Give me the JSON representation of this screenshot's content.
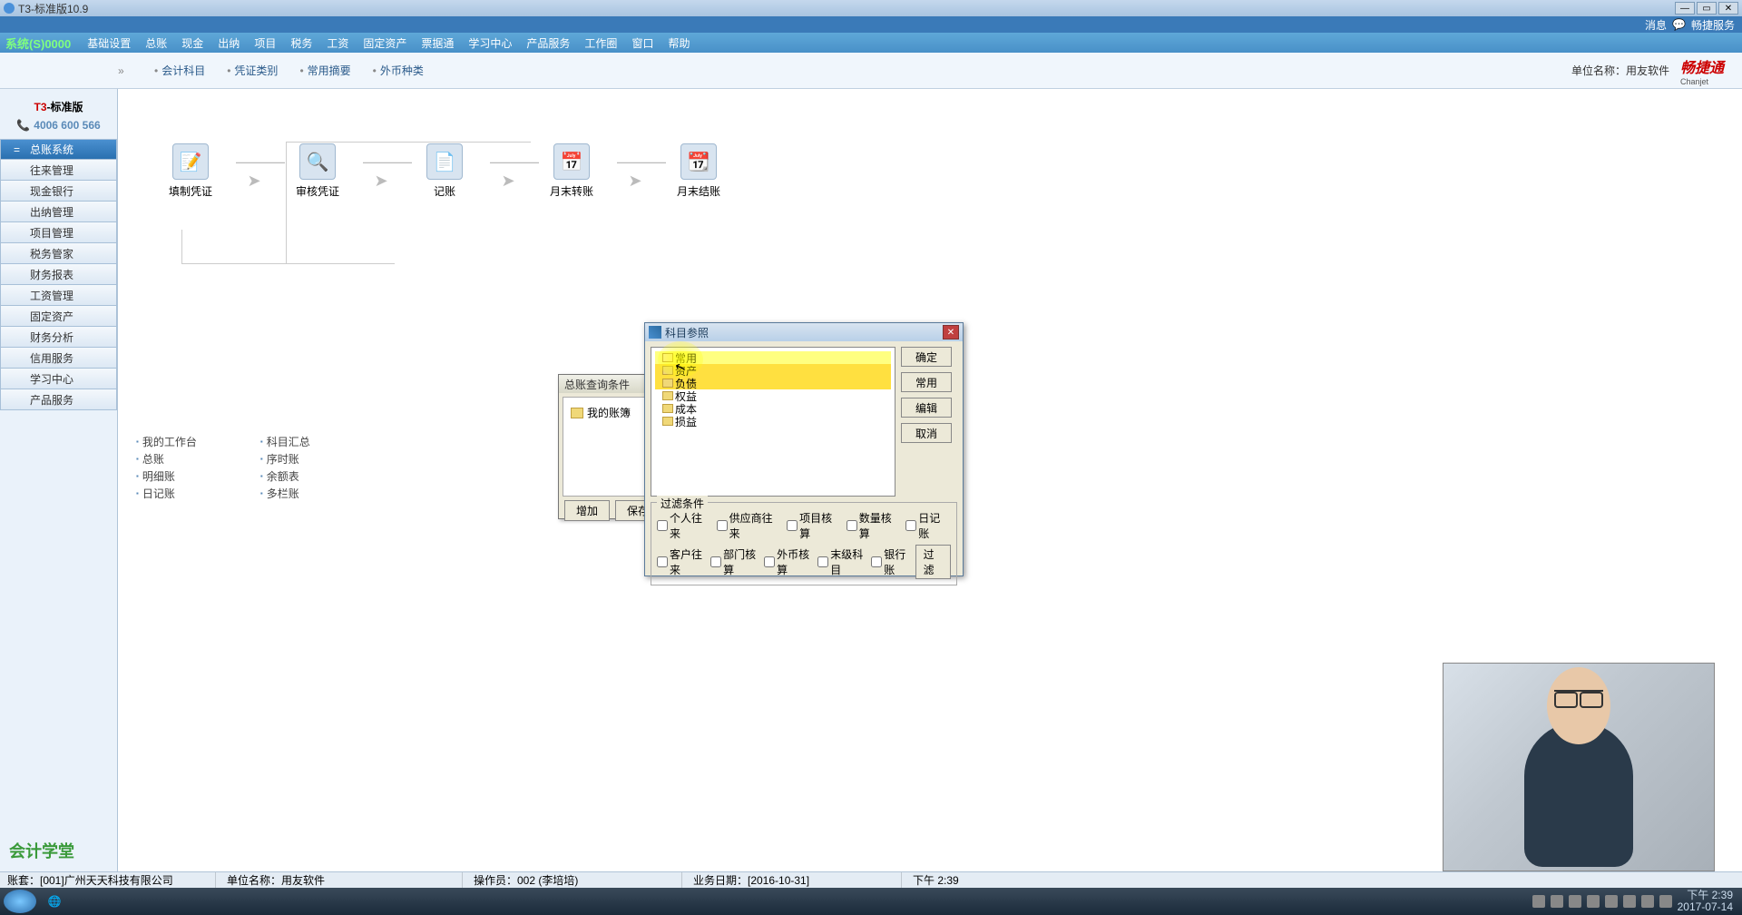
{
  "window": {
    "title": "T3-标准版10.9"
  },
  "topnotify": {
    "msg": "消息",
    "service": "畅捷服务"
  },
  "menubar": {
    "brand": "系统(S)0000",
    "items": [
      "基础设置",
      "总账",
      "现金",
      "出纳",
      "项目",
      "税务",
      "工资",
      "固定资产",
      "票据通",
      "学习中心",
      "产品服务",
      "工作圈",
      "窗口",
      "帮助"
    ]
  },
  "toolbar": {
    "tabs": [
      "会计科目",
      "凭证类别",
      "常用摘要",
      "外币种类"
    ],
    "unitlabel": "单位名称：用友软件",
    "brand": "畅捷通",
    "brandsub": "Chanjet"
  },
  "sidebar": {
    "logo": {
      "t3a": "T3",
      "t3b": "-标准版",
      "phone": "4006 600 566"
    },
    "items": [
      "总账系统",
      "往来管理",
      "现金银行",
      "出纳管理",
      "项目管理",
      "税务管家",
      "财务报表",
      "工资管理",
      "固定资产",
      "财务分析",
      "信用服务",
      "学习中心",
      "产品服务"
    ],
    "active": 0,
    "bottom": "会计学堂"
  },
  "workflow": {
    "steps": [
      "填制凭证",
      "审核凭证",
      "记账",
      "月末转账",
      "月末结账"
    ]
  },
  "bottomlinks": {
    "col1": [
      "我的工作台",
      "总账",
      "明细账",
      "日记账"
    ],
    "col2": [
      "科目汇总",
      "序时账",
      "余额表",
      "多栏账"
    ]
  },
  "dialog_behind": {
    "title": "总账查询条件",
    "tree_item": "我的账簿",
    "btn_add": "增加",
    "btn_save": "保存"
  },
  "dialog": {
    "title": "科目参照",
    "tree": [
      "常用",
      "资产",
      "负债",
      "权益",
      "成本",
      "损益"
    ],
    "buttons": {
      "ok": "确定",
      "common": "常用",
      "edit": "编辑",
      "cancel": "取消"
    },
    "filter": {
      "legend": "过滤条件",
      "row1": [
        "个人往来",
        "供应商往来",
        "项目核算",
        "数量核算",
        "日记账"
      ],
      "row2": [
        "客户往来",
        "部门核算",
        "外币核算",
        "末级科目",
        "银行账"
      ],
      "btn": "过滤"
    }
  },
  "statusbar": {
    "account": "账套：[001]广州天天科技有限公司",
    "unit": "单位名称：用友软件",
    "operator": "操作员：002 (李培培)",
    "date": "业务日期：[2016-10-31]",
    "time": "下午 2:39"
  },
  "taskbar": {
    "clock_time": "下午 2:39",
    "clock_date": "2017-07-14"
  }
}
